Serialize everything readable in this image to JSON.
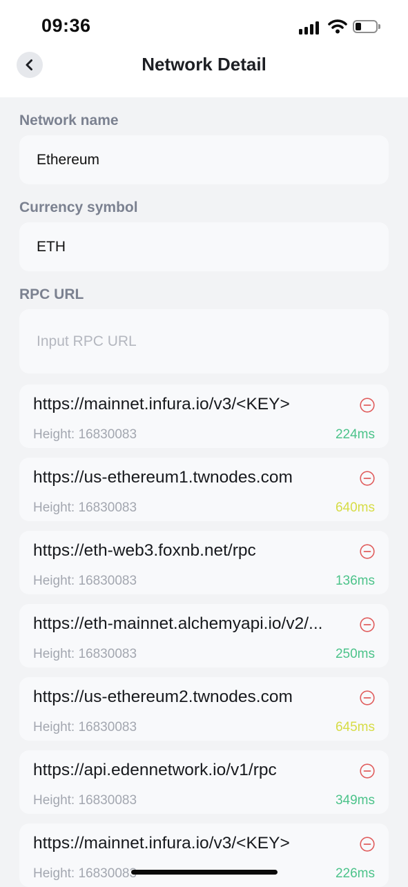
{
  "status_bar": {
    "time": "09:36",
    "icons": [
      "cellular-signal-icon",
      "wifi-icon",
      "battery-icon"
    ]
  },
  "header": {
    "title": "Network Detail",
    "back_icon": "chevron-left-icon"
  },
  "form": {
    "network_name_label": "Network name",
    "network_name_value": "Ethereum",
    "currency_symbol_label": "Currency symbol",
    "currency_symbol_value": "ETH",
    "rpc_url_label": "RPC URL",
    "rpc_url_placeholder": "Input RPC URL"
  },
  "rpc_list": [
    {
      "url": "https://mainnet.infura.io/v3/<KEY>",
      "height": "Height: 16830083",
      "latency": "224ms",
      "latency_color": "#4cc38a"
    },
    {
      "url": "https://us-ethereum1.twnodes.com",
      "height": "Height: 16830083",
      "latency": "640ms",
      "latency_color": "#d6dc45"
    },
    {
      "url": "https://eth-web3.foxnb.net/rpc",
      "height": "Height: 16830083",
      "latency": "136ms",
      "latency_color": "#4cc38a"
    },
    {
      "url": "https://eth-mainnet.alchemyapi.io/v2/...",
      "height": "Height: 16830083",
      "latency": "250ms",
      "latency_color": "#4cc38a"
    },
    {
      "url": "https://us-ethereum2.twnodes.com",
      "height": "Height: 16830083",
      "latency": "645ms",
      "latency_color": "#d6dc45"
    },
    {
      "url": "https://api.edennetwork.io/v1/rpc",
      "height": "Height: 16830083",
      "latency": "349ms",
      "latency_color": "#4cc38a"
    },
    {
      "url": "https://mainnet.infura.io/v3/<KEY>",
      "height": "Height: 16830083",
      "latency": "226ms",
      "latency_color": "#4cc38a"
    }
  ],
  "colors": {
    "remove_icon": "#e05c5c",
    "latency_good": "#4cc38a",
    "latency_slow": "#d6dc45"
  },
  "remove_icon": "minus-circle-icon"
}
